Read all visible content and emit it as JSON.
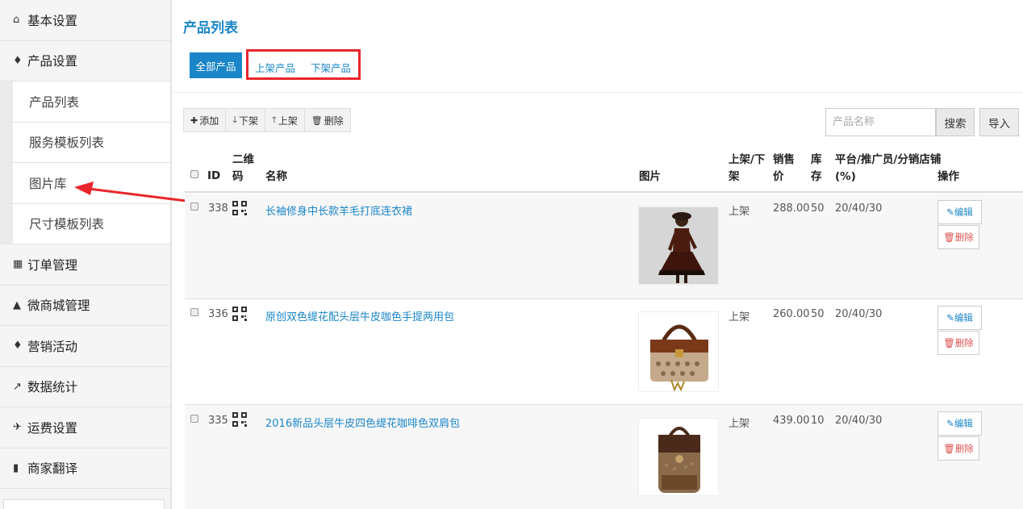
{
  "sidebar": {
    "items": [
      {
        "icon": "home-icon",
        "glyph": "⌂",
        "label": "基本设置"
      },
      {
        "icon": "gift-icon",
        "glyph": "♦",
        "label": "产品设置"
      }
    ],
    "sub_items": [
      {
        "label": "产品列表"
      },
      {
        "label": "服务模板列表"
      },
      {
        "label": "图片库"
      },
      {
        "label": "尺寸模板列表"
      }
    ],
    "items2": [
      {
        "icon": "calendar-icon",
        "glyph": "▦",
        "label": "订单管理"
      },
      {
        "icon": "shopping-bag-icon",
        "glyph": "▲",
        "label": "微商城管理"
      },
      {
        "icon": "gift-icon",
        "glyph": "♦",
        "label": "营销活动"
      },
      {
        "icon": "line-chart-icon",
        "glyph": "↗",
        "label": "数据统计"
      },
      {
        "icon": "plane-icon",
        "glyph": "✈",
        "label": "运费设置"
      },
      {
        "icon": "book-icon",
        "glyph": "▮",
        "label": "商家翻译"
      }
    ]
  },
  "main": {
    "title": "产品列表",
    "tabs": {
      "all": "全部产品",
      "on_shelf": "上架产品",
      "off_shelf": "下架产品"
    },
    "toolbar": {
      "add": "添加",
      "down": "下架",
      "up": "上架",
      "delete": "删除"
    },
    "search": {
      "placeholder": "产品名称",
      "button": "搜索",
      "import": "导入"
    },
    "table": {
      "headers": {
        "id": "ID",
        "qr_line1": "二维",
        "qr_line2": "码",
        "name": "名称",
        "image": "图片",
        "shelf_line1": "上架/下",
        "shelf_line2": "架",
        "price_line1": "销售",
        "price_line2": "价",
        "stock_line1": "库",
        "stock_line2": "存",
        "ratio_line1": "平台/推广员/分销店铺",
        "ratio_line2": "(%)",
        "actions": "操作"
      },
      "rows": [
        {
          "id": "338",
          "name": "长袖修身中长款羊毛打底连衣裙",
          "status": "上架",
          "price": "288.00",
          "stock": "50",
          "ratio": "20/40/30",
          "edit": "编辑",
          "delete": "删除"
        },
        {
          "id": "336",
          "name": "原创双色缇花配头层牛皮咖色手提两用包",
          "status": "上架",
          "price": "260.00",
          "stock": "50",
          "ratio": "20/40/30",
          "edit": "编辑",
          "delete": "删除"
        },
        {
          "id": "335",
          "name": "2016新品头层牛皮四色缇花咖啡色双肩包",
          "status": "上架",
          "price": "439.00",
          "stock": "10",
          "ratio": "20/40/30",
          "edit": "编辑",
          "delete": "删除"
        }
      ]
    }
  },
  "colors": {
    "accent": "#1a86c8",
    "highlight": "#e8262b",
    "danger": "#d9534f"
  }
}
